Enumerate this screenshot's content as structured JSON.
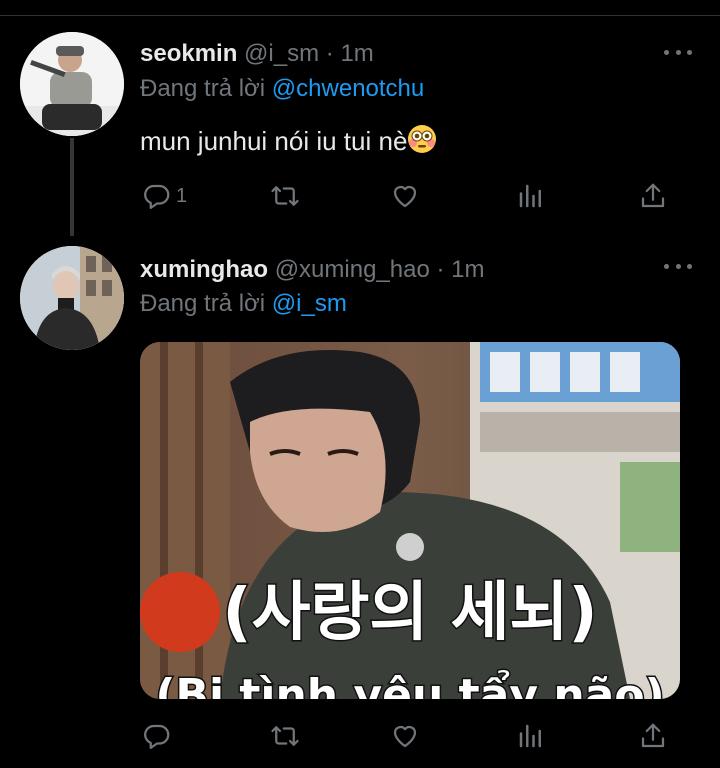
{
  "tweets": [
    {
      "name": "seokmin",
      "handle": "@i_sm",
      "separator": "·",
      "time": "1m",
      "replying_prefix": "Đang trả lời ",
      "replying_to": "@chwenotchu",
      "text": "mun junhui nói iu tui nè",
      "emoji": "flushed-face-emoji",
      "reply_count": "1"
    },
    {
      "name": "xuminghao",
      "handle": "@xuming_hao",
      "separator": "·",
      "time": "1m",
      "replying_prefix": "Đang trả lời ",
      "replying_to": "@i_sm",
      "media": {
        "caption_korean": "(사랑의 세뇌)",
        "caption_vietnamese": "(Bị tình yêu tẩy não)"
      }
    }
  ],
  "icons": {
    "reply": "reply-icon",
    "retweet": "retweet-icon",
    "like": "heart-icon",
    "analytics": "analytics-icon",
    "share": "share-icon",
    "more": "more-icon"
  },
  "colors": {
    "background": "#000000",
    "link": "#1d9bf0",
    "secondary": "#71767b",
    "text": "#e7e9ea"
  }
}
